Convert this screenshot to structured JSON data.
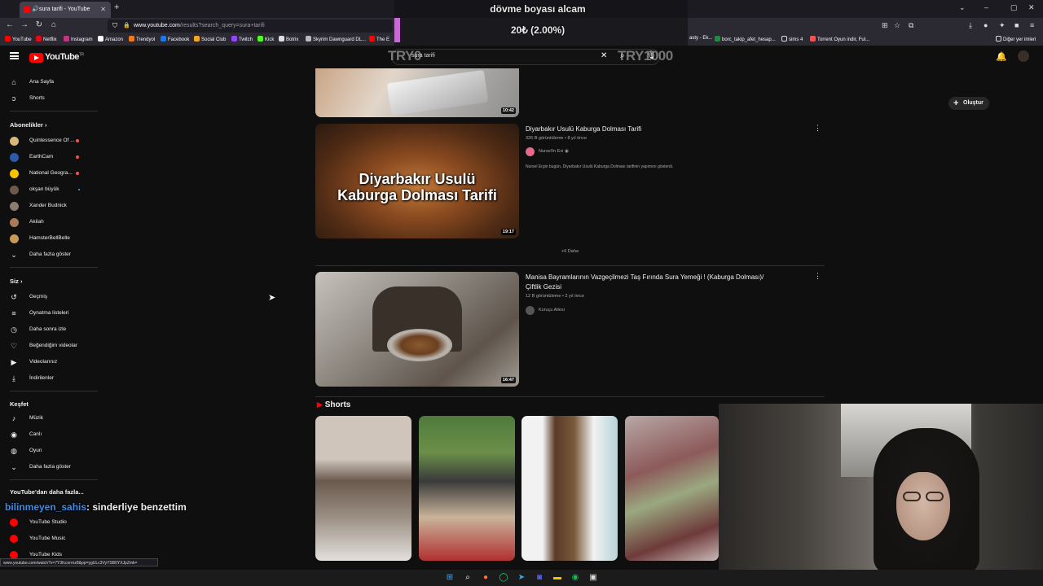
{
  "browser": {
    "tab_title": "sura tarifi - YouTube",
    "url_host": "www.youtube.com",
    "url_path": "/results?search_query=sura+tarifi",
    "bookmarks": [
      "YouTube",
      "Netflix",
      "Instagram",
      "Amazon",
      "Trendyol",
      "Facebook",
      "Social Club",
      "Twitch",
      "Kick",
      "Botrix",
      "Skyrim Dawnguard DL...",
      "The E"
    ],
    "bookmarks_right": [
      "asty - Ek...",
      "borc_takip_afet_hesap...",
      "sims 4",
      "Torrent Oyun indir, Ful...",
      "Diğer yer imleri"
    ],
    "status_url": "www.youtube.com/watch?v=7Y3fccorrnz8&pp=ygULc3VyYSB0YXJpZmk="
  },
  "youtube": {
    "logo_text": "YouTube",
    "logo_sup": "TR",
    "search_value": "sura tarifi",
    "create_label": "Oluştur"
  },
  "sidebar": {
    "top": [
      {
        "label": "Ana Sayfa",
        "icon": "home-icon",
        "glyph": "⌂"
      },
      {
        "label": "Shorts",
        "icon": "shorts-icon",
        "glyph": "ↄ"
      }
    ],
    "subs_heading": "Abonelikler",
    "subscriptions": [
      {
        "label": "Quintessence Of ...",
        "color": "#d9b77a",
        "live": true
      },
      {
        "label": "EarthCam",
        "color": "#2d5aa8",
        "live": true
      },
      {
        "label": "National Geogra...",
        "color": "#f5c400",
        "live": true
      },
      {
        "label": "okşan büyük",
        "color": "#6d5a4a",
        "live": false,
        "dot": true
      },
      {
        "label": "Xander Budnick",
        "color": "#8a7d6f",
        "live": false
      },
      {
        "label": "Akilah",
        "color": "#a87a5a",
        "live": false
      },
      {
        "label": "HamsterBellBelle",
        "color": "#c89a58",
        "live": false
      }
    ],
    "subs_more": "Daha fazla göster",
    "you_heading": "Siz",
    "you_items": [
      {
        "label": "Geçmiş",
        "icon": "history-icon",
        "glyph": "↺"
      },
      {
        "label": "Oynatma listeleri",
        "icon": "playlists-icon",
        "glyph": "≡"
      },
      {
        "label": "Daha sonra izle",
        "icon": "watch-later-icon",
        "glyph": "◷"
      },
      {
        "label": "Beğendiğim videolar",
        "icon": "like-icon",
        "glyph": "👍"
      },
      {
        "label": "Videolarınız",
        "icon": "your-videos-icon",
        "glyph": "▶"
      },
      {
        "label": "İndirilenler",
        "icon": "download-icon",
        "glyph": "⤓"
      }
    ],
    "explore_heading": "Keşfet",
    "explore_items": [
      {
        "label": "Müzik",
        "icon": "music-icon",
        "glyph": "♪"
      },
      {
        "label": "Canlı",
        "icon": "live-icon",
        "glyph": "◉"
      },
      {
        "label": "Oyun",
        "icon": "gaming-icon",
        "glyph": "◍"
      }
    ],
    "explore_more": "Daha fazla göster",
    "more_heading": "YouTube'dan daha fazla...",
    "more_items": [
      {
        "label": "YouTube Studio"
      },
      {
        "label": "YouTube Music"
      },
      {
        "label": "YouTube Kids"
      }
    ]
  },
  "results": {
    "video0": {
      "duration": "10:42"
    },
    "video1": {
      "title": "Diyarbakır Usulü Kaburga Dolması Tarifi",
      "meta": "326 B görüntüleme • 8 yıl önce",
      "channel": "Nursel'in Evi",
      "desc": "Nursel Ergin bugün, Diyarbakır Usulü Kaburga Dolması tarifinin yapımını gösterdi.",
      "duration": "19:17",
      "thumb_line1": "Diyarbakır Usulü",
      "thumb_line2": "Kaburga Dolması Tarifi"
    },
    "more_button": "+6 Daha",
    "video2": {
      "title_line1": "Manisa Bayramlarının Vazgeçilmezi Taş Fırında Sura Yemeği ! (Kaburga Dolması)/",
      "title_line2": "Çiftlik Gezisi",
      "meta": "12 B görüntüleme • 2 yıl önce",
      "channel": "Kuruçu Ailesi",
      "duration": "16:47"
    },
    "shorts_heading": "Shorts"
  },
  "overlays": {
    "goal_title": "dövme boyası alcam",
    "goal_progress": "20₺ (2.00%)",
    "goal_progress_fraction": 0.02,
    "goal_start": "TRY0",
    "goal_end": "TRY1000",
    "chat_user": "bilinmeyen_sahis",
    "chat_message": ": sinderliye benzettim"
  },
  "colors": {
    "accent_red": "#ff0000",
    "goal_bar": "#c86ad6",
    "chat_user": "#3b8ce8"
  }
}
